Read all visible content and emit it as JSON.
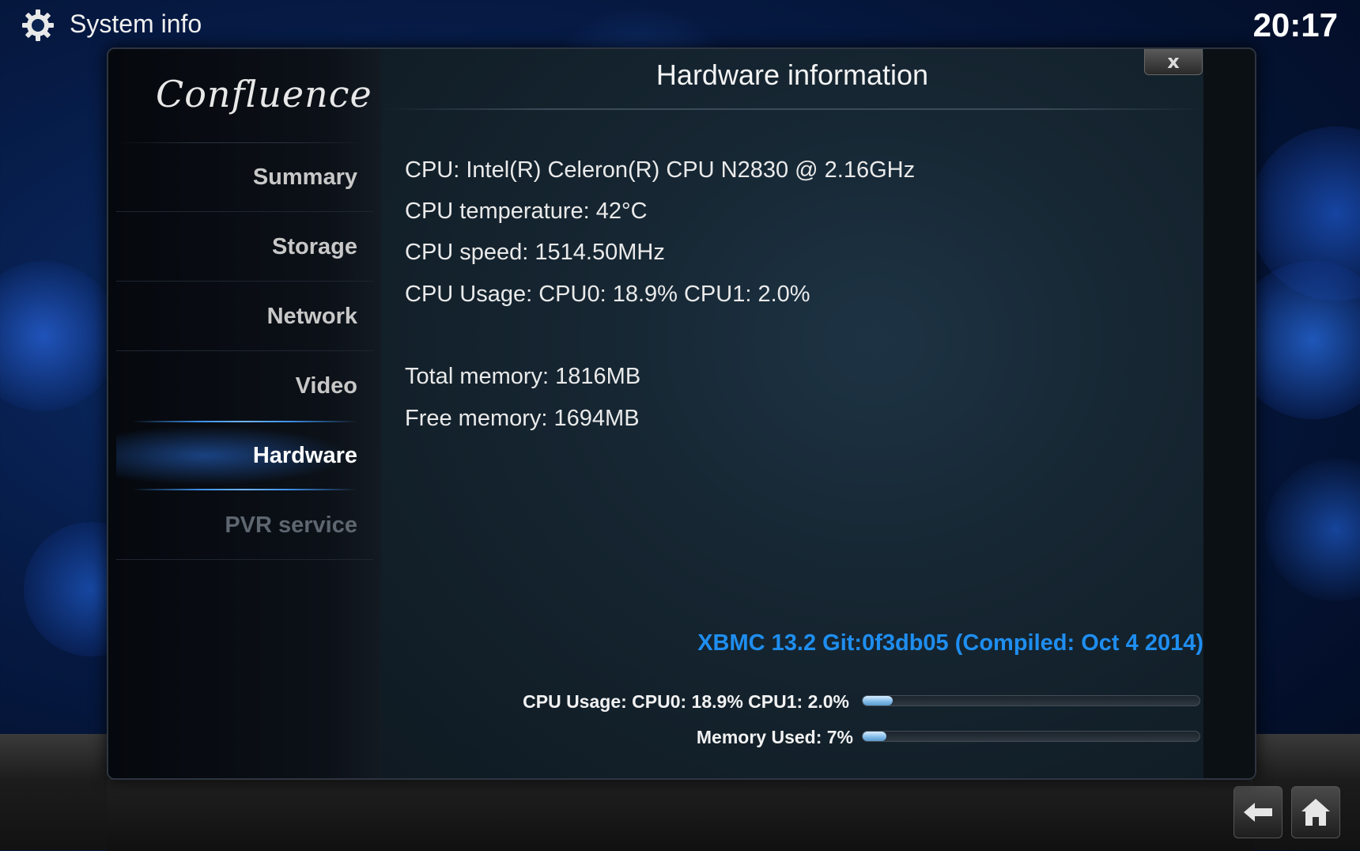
{
  "topbar": {
    "title": "System info",
    "clock": "20:17"
  },
  "sidebar": {
    "logo": "Confluence",
    "items": [
      {
        "label": "Summary"
      },
      {
        "label": "Storage"
      },
      {
        "label": "Network"
      },
      {
        "label": "Video"
      },
      {
        "label": "Hardware",
        "active": true
      },
      {
        "label": "PVR service",
        "disabled": true
      }
    ]
  },
  "dialog": {
    "title": "Hardware information",
    "close_label": "x",
    "info": [
      "CPU: Intel(R) Celeron(R) CPU N2830 @ 2.16GHz",
      "CPU temperature: 42°C",
      "CPU speed: 1514.50MHz",
      "CPU Usage: CPU0: 18.9% CPU1: 2.0%",
      "Total memory: 1816MB",
      "Free memory: 1694MB"
    ],
    "version": "XBMC 13.2 Git:0f3db05 (Compiled: Oct  4 2014)",
    "bars": [
      {
        "label": "CPU Usage: CPU0: 18.9% CPU1: 2.0%",
        "fraction": 0.09
      },
      {
        "label": "Memory Used: 7%",
        "fraction": 0.07
      }
    ]
  },
  "icons": {
    "settings": "gear-icon",
    "back": "back-arrow-icon",
    "home": "home-icon",
    "close": "close-icon"
  },
  "colors": {
    "accent": "#1f8ef0",
    "background": "#061a44"
  }
}
